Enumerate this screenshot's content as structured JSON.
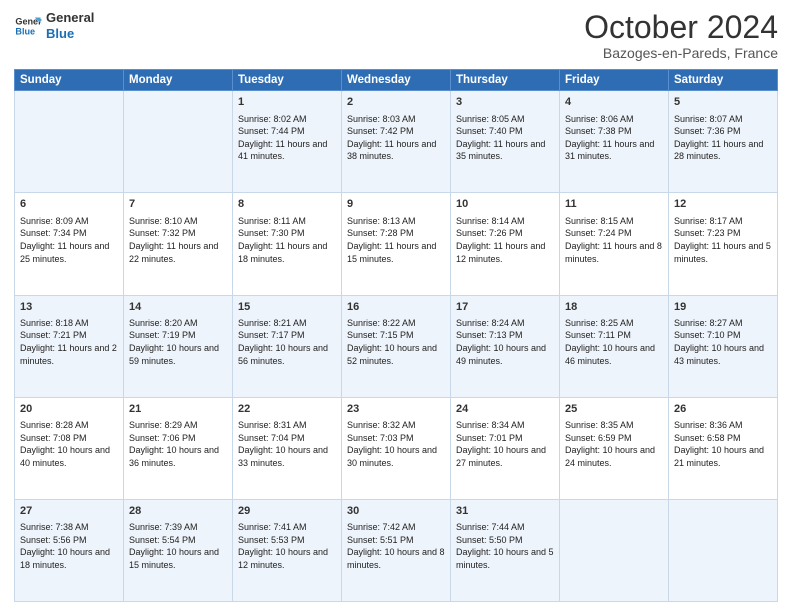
{
  "logo": {
    "line1": "General",
    "line2": "Blue"
  },
  "title": "October 2024",
  "location": "Bazoges-en-Pareds, France",
  "days_of_week": [
    "Sunday",
    "Monday",
    "Tuesday",
    "Wednesday",
    "Thursday",
    "Friday",
    "Saturday"
  ],
  "weeks": [
    [
      {
        "day": "",
        "info": ""
      },
      {
        "day": "",
        "info": ""
      },
      {
        "day": "1",
        "info": "Sunrise: 8:02 AM\nSunset: 7:44 PM\nDaylight: 11 hours and 41 minutes."
      },
      {
        "day": "2",
        "info": "Sunrise: 8:03 AM\nSunset: 7:42 PM\nDaylight: 11 hours and 38 minutes."
      },
      {
        "day": "3",
        "info": "Sunrise: 8:05 AM\nSunset: 7:40 PM\nDaylight: 11 hours and 35 minutes."
      },
      {
        "day": "4",
        "info": "Sunrise: 8:06 AM\nSunset: 7:38 PM\nDaylight: 11 hours and 31 minutes."
      },
      {
        "day": "5",
        "info": "Sunrise: 8:07 AM\nSunset: 7:36 PM\nDaylight: 11 hours and 28 minutes."
      }
    ],
    [
      {
        "day": "6",
        "info": "Sunrise: 8:09 AM\nSunset: 7:34 PM\nDaylight: 11 hours and 25 minutes."
      },
      {
        "day": "7",
        "info": "Sunrise: 8:10 AM\nSunset: 7:32 PM\nDaylight: 11 hours and 22 minutes."
      },
      {
        "day": "8",
        "info": "Sunrise: 8:11 AM\nSunset: 7:30 PM\nDaylight: 11 hours and 18 minutes."
      },
      {
        "day": "9",
        "info": "Sunrise: 8:13 AM\nSunset: 7:28 PM\nDaylight: 11 hours and 15 minutes."
      },
      {
        "day": "10",
        "info": "Sunrise: 8:14 AM\nSunset: 7:26 PM\nDaylight: 11 hours and 12 minutes."
      },
      {
        "day": "11",
        "info": "Sunrise: 8:15 AM\nSunset: 7:24 PM\nDaylight: 11 hours and 8 minutes."
      },
      {
        "day": "12",
        "info": "Sunrise: 8:17 AM\nSunset: 7:23 PM\nDaylight: 11 hours and 5 minutes."
      }
    ],
    [
      {
        "day": "13",
        "info": "Sunrise: 8:18 AM\nSunset: 7:21 PM\nDaylight: 11 hours and 2 minutes."
      },
      {
        "day": "14",
        "info": "Sunrise: 8:20 AM\nSunset: 7:19 PM\nDaylight: 10 hours and 59 minutes."
      },
      {
        "day": "15",
        "info": "Sunrise: 8:21 AM\nSunset: 7:17 PM\nDaylight: 10 hours and 56 minutes."
      },
      {
        "day": "16",
        "info": "Sunrise: 8:22 AM\nSunset: 7:15 PM\nDaylight: 10 hours and 52 minutes."
      },
      {
        "day": "17",
        "info": "Sunrise: 8:24 AM\nSunset: 7:13 PM\nDaylight: 10 hours and 49 minutes."
      },
      {
        "day": "18",
        "info": "Sunrise: 8:25 AM\nSunset: 7:11 PM\nDaylight: 10 hours and 46 minutes."
      },
      {
        "day": "19",
        "info": "Sunrise: 8:27 AM\nSunset: 7:10 PM\nDaylight: 10 hours and 43 minutes."
      }
    ],
    [
      {
        "day": "20",
        "info": "Sunrise: 8:28 AM\nSunset: 7:08 PM\nDaylight: 10 hours and 40 minutes."
      },
      {
        "day": "21",
        "info": "Sunrise: 8:29 AM\nSunset: 7:06 PM\nDaylight: 10 hours and 36 minutes."
      },
      {
        "day": "22",
        "info": "Sunrise: 8:31 AM\nSunset: 7:04 PM\nDaylight: 10 hours and 33 minutes."
      },
      {
        "day": "23",
        "info": "Sunrise: 8:32 AM\nSunset: 7:03 PM\nDaylight: 10 hours and 30 minutes."
      },
      {
        "day": "24",
        "info": "Sunrise: 8:34 AM\nSunset: 7:01 PM\nDaylight: 10 hours and 27 minutes."
      },
      {
        "day": "25",
        "info": "Sunrise: 8:35 AM\nSunset: 6:59 PM\nDaylight: 10 hours and 24 minutes."
      },
      {
        "day": "26",
        "info": "Sunrise: 8:36 AM\nSunset: 6:58 PM\nDaylight: 10 hours and 21 minutes."
      }
    ],
    [
      {
        "day": "27",
        "info": "Sunrise: 7:38 AM\nSunset: 5:56 PM\nDaylight: 10 hours and 18 minutes."
      },
      {
        "day": "28",
        "info": "Sunrise: 7:39 AM\nSunset: 5:54 PM\nDaylight: 10 hours and 15 minutes."
      },
      {
        "day": "29",
        "info": "Sunrise: 7:41 AM\nSunset: 5:53 PM\nDaylight: 10 hours and 12 minutes."
      },
      {
        "day": "30",
        "info": "Sunrise: 7:42 AM\nSunset: 5:51 PM\nDaylight: 10 hours and 8 minutes."
      },
      {
        "day": "31",
        "info": "Sunrise: 7:44 AM\nSunset: 5:50 PM\nDaylight: 10 hours and 5 minutes."
      },
      {
        "day": "",
        "info": ""
      },
      {
        "day": "",
        "info": ""
      }
    ]
  ]
}
